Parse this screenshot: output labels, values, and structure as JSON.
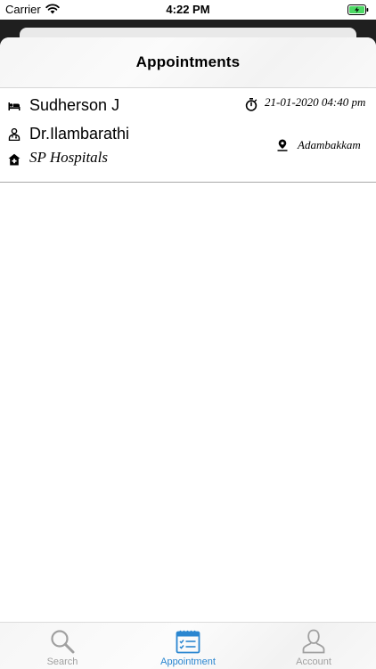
{
  "status_bar": {
    "carrier": "Carrier",
    "time": "4:22 PM"
  },
  "header": {
    "title": "Appointments"
  },
  "appointments": [
    {
      "patient": "Sudherson J",
      "doctor": "Dr.Ilambarathi",
      "hospital": "SP Hospitals",
      "datetime": "21-01-2020 04:40 pm",
      "location": "Adambakkam"
    }
  ],
  "tab_bar": {
    "tabs": [
      {
        "label": "Search",
        "icon": "search-icon",
        "active": false
      },
      {
        "label": "Appointment",
        "icon": "calendar-icon",
        "active": true
      },
      {
        "label": "Account",
        "icon": "user-icon",
        "active": false
      }
    ]
  },
  "colors": {
    "accent": "#2a86d0",
    "inactive": "#a0a0a0",
    "battery": "#4cd964"
  }
}
